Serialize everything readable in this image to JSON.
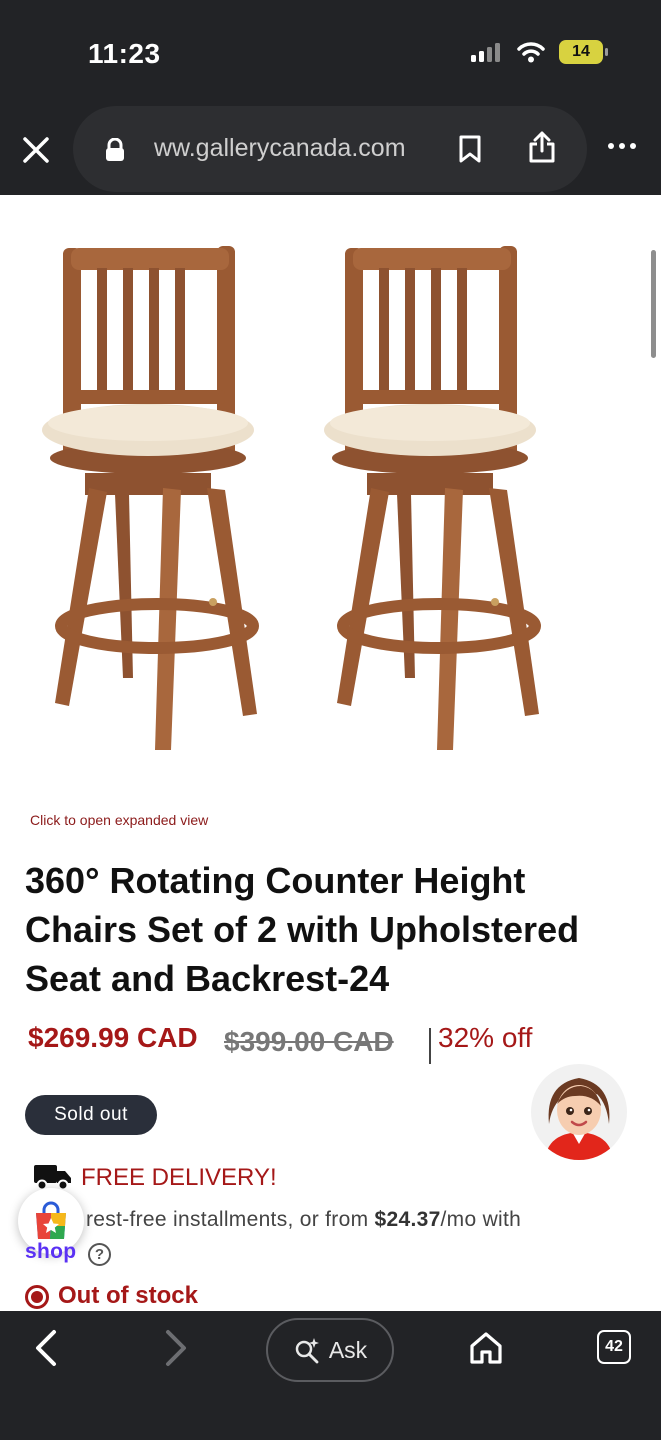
{
  "status_bar": {
    "time": "11:23",
    "battery": "14"
  },
  "browser": {
    "url": "ww.gallerycanada.com",
    "tab_count": "42",
    "ask_label": "Ask"
  },
  "product": {
    "expand_hint": "Click to open expanded view",
    "title": "360° Rotating Counter Height Chairs Set of 2 with Upholstered Seat and Backrest-24",
    "price": "$269.99 CAD",
    "original_price": "$399.00 CAD",
    "discount": "32% off",
    "badge": "Sold out",
    "delivery": "FREE DELIVERY!",
    "installments_prefix": "rest-free installments, or from ",
    "installments_amount": "$24.37",
    "installments_suffix": "/mo with",
    "shop_brand": "shop",
    "help_glyph": "?",
    "stock_status": "Out of stock"
  },
  "colors": {
    "accent_red": "#a51818",
    "shop_purple": "#5a31f4",
    "chrome_dark": "#222326",
    "wood": "#9a5a33",
    "cushion": "#ece0cc"
  },
  "icons": [
    "signal-icon",
    "wifi-icon",
    "battery-icon",
    "close-icon",
    "lock-icon",
    "bookmark-icon",
    "share-icon",
    "more-icon",
    "truck-icon",
    "shop-bag-icon",
    "help-icon",
    "back-icon",
    "forward-icon",
    "ask-sparkle-icon",
    "home-icon",
    "tabs-icon"
  ]
}
